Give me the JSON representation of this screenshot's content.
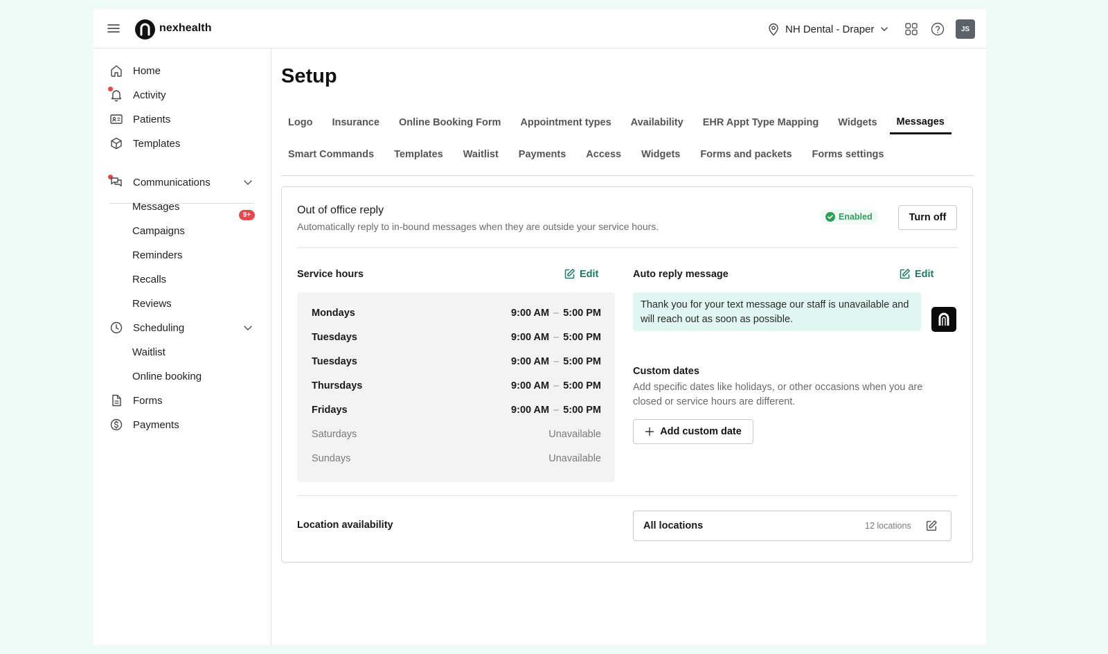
{
  "topbar": {
    "brand": "nexhealth",
    "location": "NH Dental - Draper",
    "avatar_initials": "JS"
  },
  "sidebar": {
    "home": "Home",
    "activity": "Activity",
    "patients": "Patients",
    "templates": "Templates",
    "communications": "Communications",
    "messages": "Messages",
    "messages_badge": "9+",
    "campaigns": "Campaigns",
    "reminders": "Reminders",
    "recalls": "Recalls",
    "reviews": "Reviews",
    "scheduling": "Scheduling",
    "waitlist": "Waitlist",
    "online_booking": "Online booking",
    "forms": "Forms",
    "payments": "Payments"
  },
  "main": {
    "title": "Setup",
    "tabs_row1": [
      "Logo",
      "Insurance",
      "Online Booking Form",
      "Appointment types",
      "Availability",
      "EHR Appt Type Mapping",
      "Widgets",
      "Messages"
    ],
    "tabs_row2": [
      "Smart Commands",
      "Templates",
      "Waitlist",
      "Payments",
      "Access",
      "Widgets",
      "Forms and packets",
      "Forms settings"
    ],
    "active_tab": "Messages"
  },
  "ooo": {
    "title": "Out of office reply",
    "subtitle": "Automatically reply to in-bound messages when they are outside your service hours.",
    "status": "Enabled",
    "turn_off": "Turn off"
  },
  "service_hours": {
    "title": "Service hours",
    "edit": "Edit",
    "rows": [
      {
        "day": "Mondays",
        "open": "9:00 AM",
        "close": "5:00 PM",
        "available": true
      },
      {
        "day": "Tuesdays",
        "open": "9:00 AM",
        "close": "5:00 PM",
        "available": true
      },
      {
        "day": "Tuesdays",
        "open": "9:00 AM",
        "close": "5:00 PM",
        "available": true
      },
      {
        "day": "Thursdays",
        "open": "9:00 AM",
        "close": "5:00 PM",
        "available": true
      },
      {
        "day": "Fridays",
        "open": "9:00 AM",
        "close": "5:00 PM",
        "available": true
      },
      {
        "day": "Saturdays",
        "status": "Unavailable",
        "available": false
      },
      {
        "day": "Sundays",
        "status": "Unavailable",
        "available": false
      }
    ],
    "separator": "–"
  },
  "auto_reply": {
    "title": "Auto reply message",
    "edit": "Edit",
    "message": "Thank you for your text message our staff is unavailable and will reach out as soon as possible."
  },
  "custom_dates": {
    "title": "Custom dates",
    "description": "Add specific dates like holidays, or other occasions when you are closed or service hours are different.",
    "add_button": "Add custom date"
  },
  "location_availability": {
    "title": "Location availability",
    "value": "All locations",
    "count": "12 locations"
  },
  "colors": {
    "accent": "#1e7a64",
    "badge": "#e5484d",
    "enabled": "#2f9e5b",
    "bubble": "#dff7f0"
  }
}
